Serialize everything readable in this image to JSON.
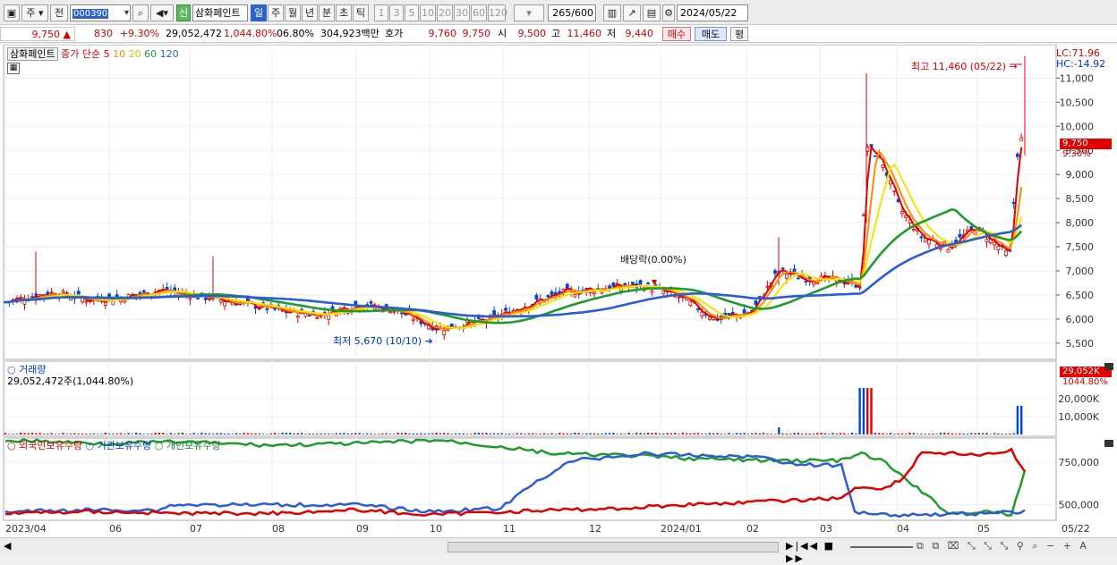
{
  "toolbar": {
    "market": "주",
    "prev": "전",
    "code": "000390",
    "name": "삼화페인트",
    "new_badge": "신",
    "periods": [
      "일",
      "주",
      "월",
      "년",
      "분",
      "초",
      "틱"
    ],
    "active_period": "일",
    "intervals": [
      "1",
      "3",
      "5",
      "10",
      "20",
      "30",
      "60",
      "120"
    ],
    "count": "265",
    "count_total": "/600",
    "date": "2024/05/22"
  },
  "info": {
    "price": "9,750",
    "arrow": "▲",
    "change": "830",
    "change_pct": "+9.30%",
    "volume": "29,052,472",
    "vol_ratio": "1,044.80%",
    "turnover": "06.80%",
    "amount": "304,923백만",
    "quote_label": "호가",
    "ask": "9,760",
    "bid": "9,750",
    "open_label": "시",
    "open": "9,500",
    "high_label": "고",
    "high": "11,460",
    "low_label": "저",
    "low": "9,440",
    "buy_btn": "매수",
    "sell_btn": "매도",
    "eval_btn": "평"
  },
  "price_panel": {
    "title": "삼화페인트",
    "ma_label": "종가 단순",
    "ma_periods": [
      "5",
      "10",
      "20",
      "60",
      "120"
    ],
    "lc": "LC:71.96",
    "hc": "HC:-14.92",
    "high_note": "최고 11,460 (05/22)",
    "low_note": "최저 5,670 (10/10)",
    "dividend_note": "배당락(0.00%)",
    "last_price": "9,750",
    "last_pct": "9.30%",
    "yticks": [
      "11,000",
      "10,500",
      "10,000",
      "9,500",
      "9,000",
      "8,500",
      "8,000",
      "7,500",
      "7,000",
      "6,500",
      "6,000",
      "5,500"
    ]
  },
  "volume_panel": {
    "title": "거래량",
    "value": "29,052,472주(1,044.80%)",
    "badge": "29,052K",
    "pct": "1044.80%",
    "yticks": [
      "20,000K",
      "10,000K"
    ]
  },
  "holding_panel": {
    "series": [
      "외국인보유수량",
      "기관보유수량",
      "개인보유수량"
    ],
    "yticks": [
      "750,000",
      "500,000"
    ]
  },
  "xaxis": {
    "labels": [
      "2023/04",
      "06",
      "07",
      "08",
      "09",
      "10",
      "11",
      "12",
      "2024/01",
      "02",
      "03",
      "04",
      "05"
    ],
    "end_label": "05/22"
  },
  "colors": {
    "up": "#e00000",
    "down": "#0047d6",
    "ma5": "#e00000",
    "ma10": "#ff8c00",
    "ma20": "#f5e400",
    "ma60": "#1f9a2e",
    "ma120": "#2b5bd7"
  }
}
